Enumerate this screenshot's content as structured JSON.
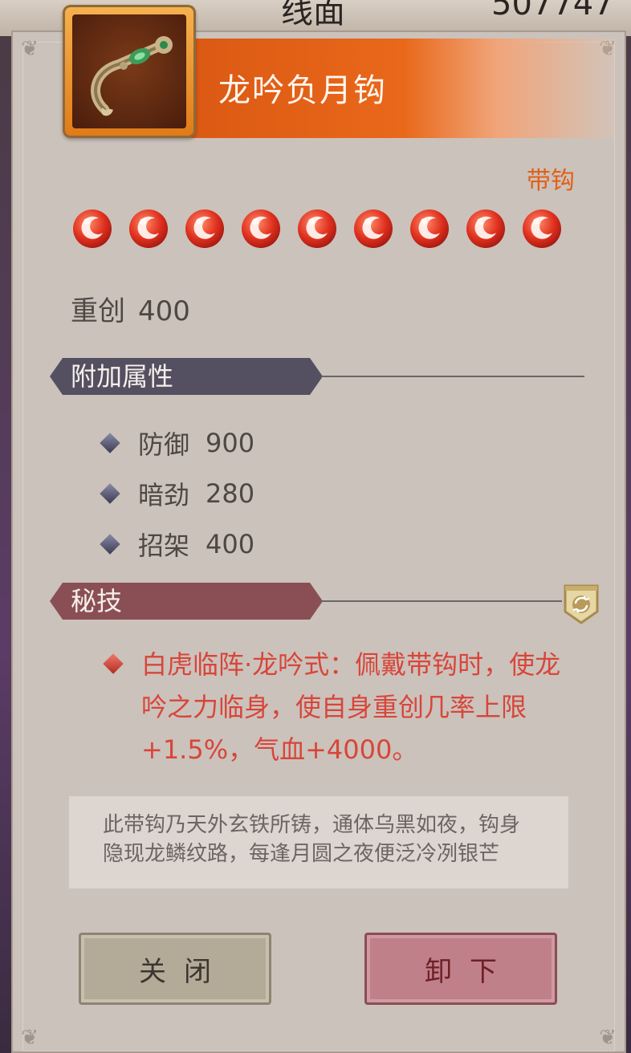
{
  "background": {
    "top_text_left": "线面",
    "top_text_right": "507747"
  },
  "item": {
    "name": "龙吟负月钩",
    "type": "带钩",
    "stars": 9,
    "base_stat": {
      "label": "重创",
      "value": "400"
    }
  },
  "attributes": {
    "header": "附加属性",
    "items": [
      {
        "label": "防御",
        "value": "900"
      },
      {
        "label": "暗劲",
        "value": "280"
      },
      {
        "label": "招架",
        "value": "400"
      }
    ]
  },
  "secret_skill": {
    "header": "秘技",
    "text": "白虎临阵·龙吟式：佩戴带钩时，使龙吟之力临身，使自身重创几率上限+1.5%，气血+4000。"
  },
  "description": "此带钩乃天外玄铁所铸，通体乌黑如夜，钩身隐现龙鳞纹路，每逢月圆之夜便泛冷冽银芒",
  "buttons": {
    "close": "关闭",
    "unequip": "卸下"
  },
  "colors": {
    "accent_orange": "#e0601a",
    "skill_red": "#d8453a",
    "panel_bg": "#cbc2bb"
  }
}
